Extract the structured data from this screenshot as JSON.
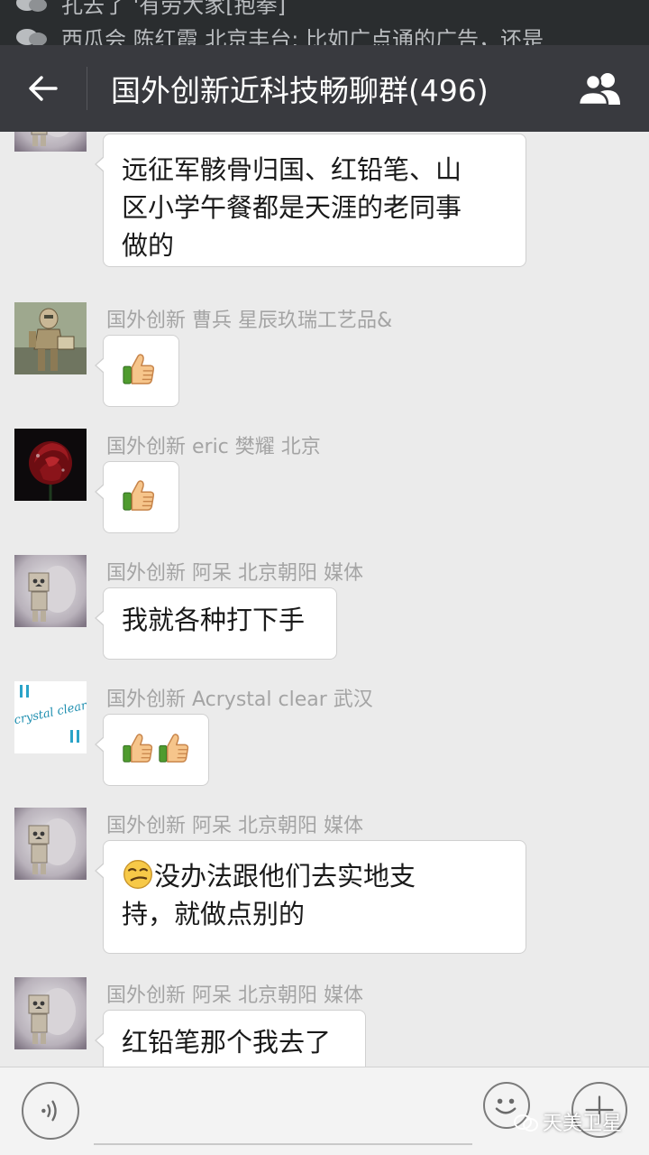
{
  "status_notifications": [
    {
      "text": "孔去了 '有劳大家[抱拳]"
    },
    {
      "text": "西瓜会 陈红霞 北京丰台: 比如广点通的广告，还是"
    }
  ],
  "header": {
    "title": "国外创新近科技畅聊群(496)",
    "back_icon": "arrow-left-icon",
    "group_icon": "group-members-icon"
  },
  "messages": [
    {
      "sender": "",
      "avatar": "danbo-doll",
      "lines": [
        "远征军骸骨归国、红铅笔、山",
        "区小学午餐都是天涯的老同事",
        "做的"
      ]
    },
    {
      "sender": "国外创新 曹兵 星辰玖瑞工艺品&",
      "avatar": "bronze-robot-statue",
      "emoji_count": 1,
      "emoji": "thumbs-up-icon"
    },
    {
      "sender": "国外创新 eric 樊耀 北京",
      "avatar": "red-rose",
      "emoji_count": 1,
      "emoji": "thumbs-up-icon"
    },
    {
      "sender": "国外创新 阿呆 北京朝阳 媒体",
      "avatar": "danbo-doll",
      "lines": [
        "我就各种打下手"
      ]
    },
    {
      "sender": "国外创新 Acrystal clear 武汉",
      "avatar": "crystal-clear-logo",
      "avatar_text": "crystal clear",
      "emoji_count": 2,
      "emoji": "thumbs-up-icon"
    },
    {
      "sender": "国外创新 阿呆 北京朝阳 媒体",
      "avatar": "danbo-doll",
      "leading_emoji": "smirk-face-icon",
      "lines": [
        "没办法跟他们去实地支",
        "持，就做点别的"
      ]
    },
    {
      "sender": "国外创新 阿呆 北京朝阳 媒体",
      "avatar": "danbo-doll",
      "lines": [
        "红铅笔那个我去了"
      ]
    }
  ],
  "bottom_bar": {
    "voice_icon": "voice-input-icon",
    "emoji_icon": "emoji-face-icon",
    "plus_icon": "plus-icon",
    "watermark": "天美卫星"
  },
  "colors": {
    "header_bg": "#393a3f",
    "status_bg": "#2a2d2f",
    "chat_bg": "#ebebeb",
    "bubble_bg": "#ffffff",
    "sender_text": "#a4a4a4"
  }
}
